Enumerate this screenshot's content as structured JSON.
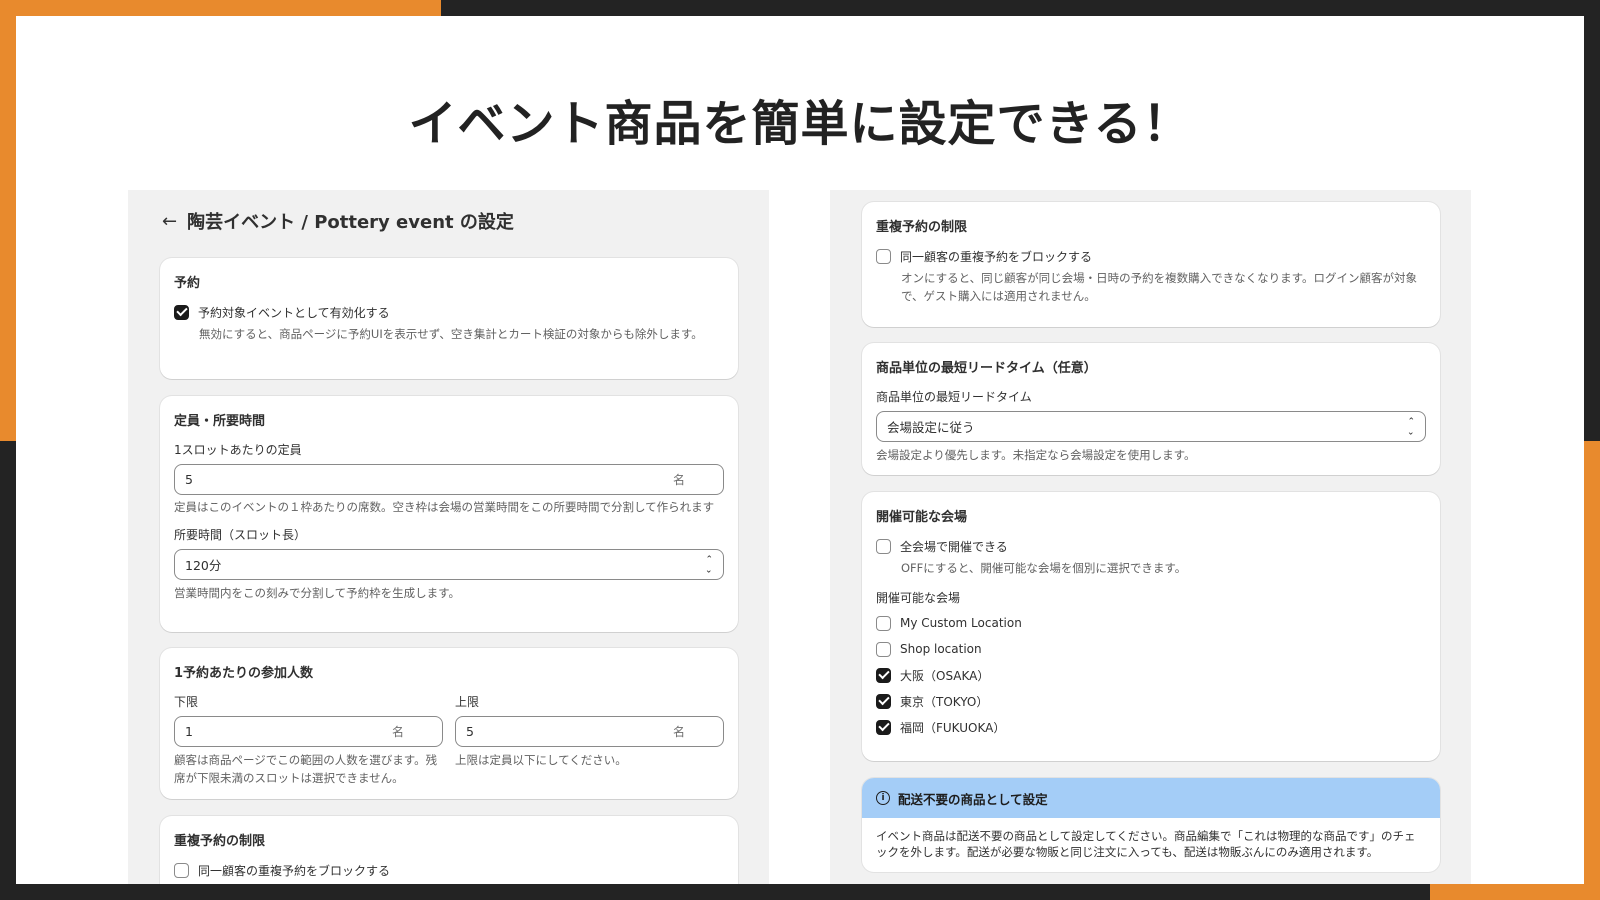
{
  "headline": "イベント商品を簡単に設定できる！",
  "left": {
    "back_arrow": "←",
    "page_title": "陶芸イベント / Pottery event の設定",
    "reservation": {
      "heading": "予約",
      "enable_label": "予約対象イベントとして有効化する",
      "enable_checked": true,
      "enable_help": "無効にすると、商品ページに予約UIを表示せず、空き集計とカート検証の対象からも除外します。"
    },
    "capacity": {
      "heading": "定員・所要時間",
      "slot_capacity_label": "1スロットあたりの定員",
      "slot_capacity_value": "5",
      "slot_capacity_suffix": "名",
      "slot_capacity_help": "定員はこのイベントの１枠あたりの席数。空き枠は会場の営業時間をこの所要時間で分割して作られます",
      "duration_label": "所要時間（スロット長）",
      "duration_value": "120分",
      "duration_help": "営業時間内をこの刻みで分割して予約枠を生成します。"
    },
    "party_size": {
      "heading": "1予約あたりの参加人数",
      "min_label": "下限",
      "min_value": "1",
      "min_suffix": "名",
      "max_label": "上限",
      "max_value": "5",
      "max_suffix": "名",
      "min_help": "顧客は商品ページでこの範囲の人数を選びます。残席が下限未満のスロットは選択できません。",
      "max_help": "上限は定員以下にしてください。"
    },
    "duplicate": {
      "heading": "重複予約の制限",
      "block_label": "同一顧客の重複予約をブロックする"
    }
  },
  "right": {
    "duplicate": {
      "heading": "重複予約の制限",
      "block_label": "同一顧客の重複予約をブロックする",
      "block_checked": false,
      "block_help": "オンにすると、同じ顧客が同じ会場・日時の予約を複数購入できなくなります。ログイン顧客が対象で、ゲスト購入には適用されません。"
    },
    "lead_time": {
      "heading": "商品単位の最短リードタイム（任意）",
      "field_label": "商品単位の最短リードタイム",
      "field_value": "会場設定に従う",
      "help": "会場設定より優先します。未指定なら会場設定を使用します。"
    },
    "venues": {
      "heading": "開催可能な会場",
      "all_label": "全会場で開催できる",
      "all_checked": false,
      "all_help": "OFFにすると、開催可能な会場を個別に選択できます。",
      "list_label": "開催可能な会場",
      "items": [
        {
          "label": "My Custom Location",
          "checked": false
        },
        {
          "label": "Shop location",
          "checked": false
        },
        {
          "label": "大阪（OSAKA）",
          "checked": true
        },
        {
          "label": "東京（TOKYO）",
          "checked": true
        },
        {
          "label": "福岡（FUKUOKA）",
          "checked": true
        }
      ]
    },
    "shipping_banner": {
      "title": "配送不要の商品として設定",
      "body": "イベント商品は配送不要の商品として設定してください。商品編集で「これは物理的な商品です」のチェックを外します。配送が必要な物販と同じ注文に入っても、配送は物販ぶんにのみ適用されます。"
    }
  },
  "colors": {
    "accent_orange": "#e88a2d",
    "dark_frame": "#232323",
    "banner_blue": "#a4cdf7"
  }
}
